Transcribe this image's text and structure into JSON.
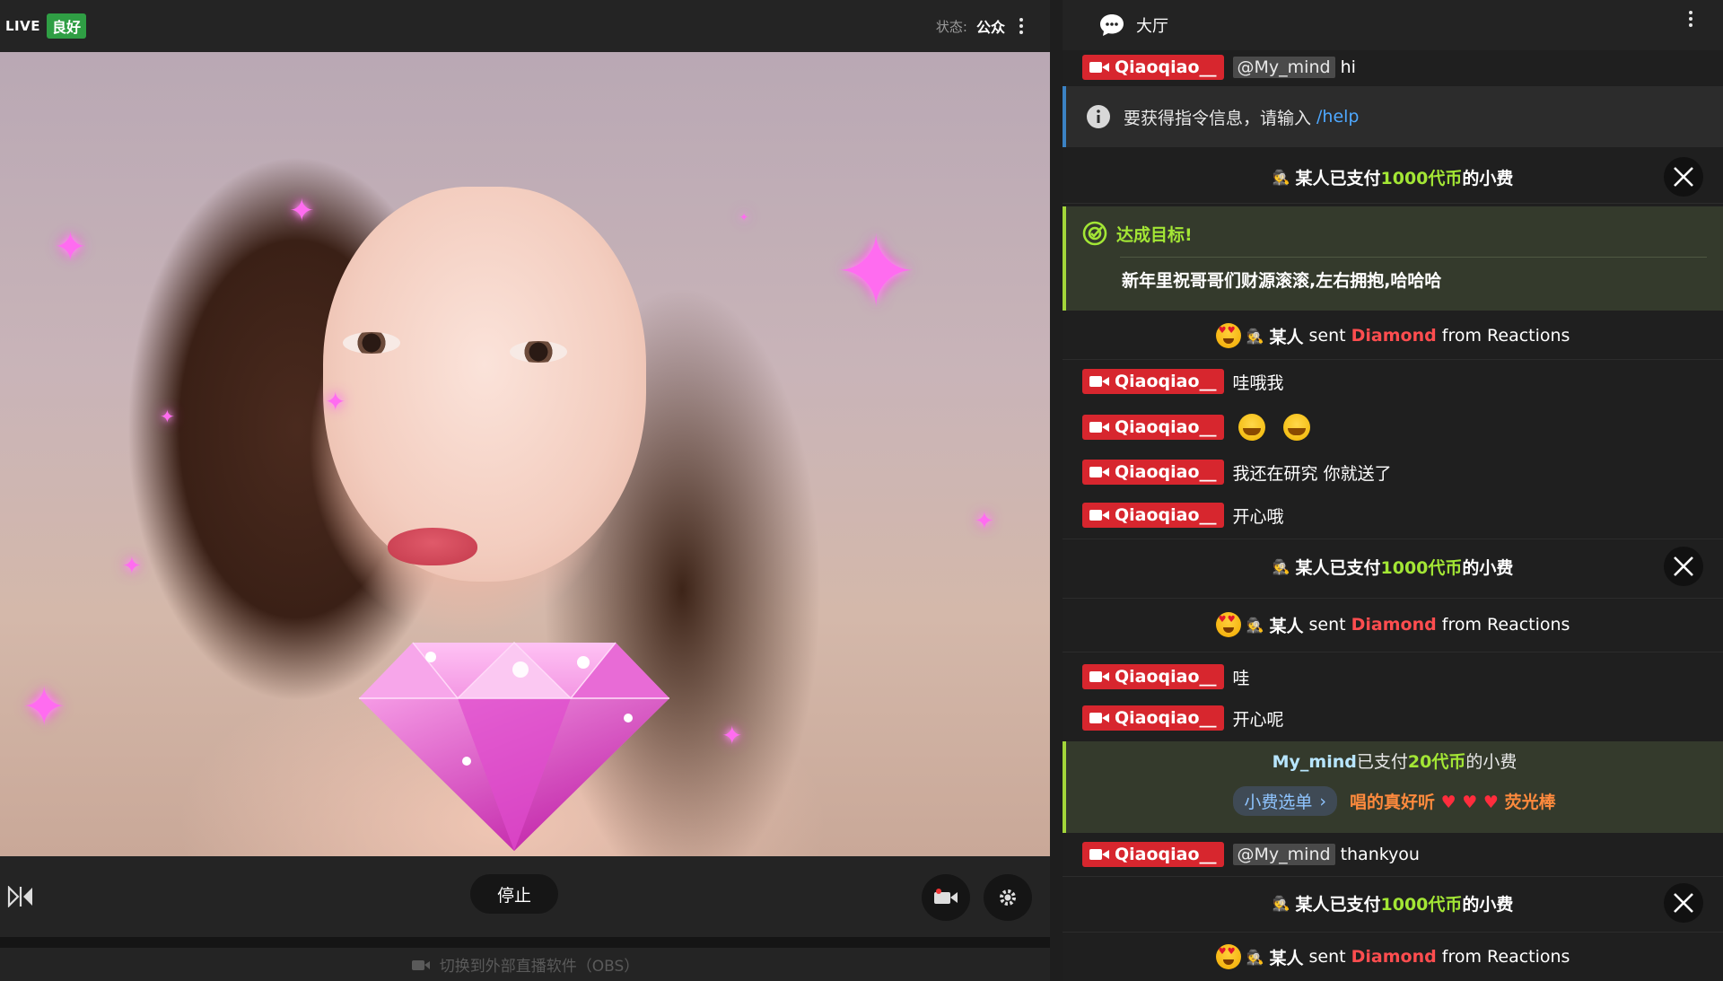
{
  "stream": {
    "live_label": "LIVE",
    "quality_badge": "良好",
    "status_label": "状态:",
    "status_value": "公众",
    "stop_label": "停止",
    "obs_label": "切换到外部直播软件（OBS）"
  },
  "chat": {
    "title": "大厅",
    "messages": [
      {
        "user": "Qiaoqiao__",
        "mention": "@My_mind",
        "text": "hi"
      },
      {
        "info_text": "要获得指令信息，请输入",
        "info_link": "/help"
      },
      {
        "tip_prefix": "某人已支付",
        "tip_amount": "1000代币",
        "tip_suffix": "的小费"
      },
      {
        "goal_title": "达成目标!",
        "goal_text": "新年里祝哥哥们财源滚滚,左右拥抱,哈哈哈"
      },
      {
        "reaction_actor": "某人",
        "reaction_verb": "sent",
        "reaction_item": "Diamond",
        "reaction_source": "from Reactions"
      },
      {
        "user": "Qiaoqiao__",
        "text": "哇哦我"
      },
      {
        "user": "Qiaoqiao__",
        "text": ""
      },
      {
        "user": "Qiaoqiao__",
        "text": "我还在研究 你就送了"
      },
      {
        "user": "Qiaoqiao__",
        "text": "开心哦"
      },
      {
        "tip_prefix": "某人已支付",
        "tip_amount": "1000代币",
        "tip_suffix": "的小费"
      },
      {
        "reaction_actor": "某人",
        "reaction_verb": "sent",
        "reaction_item": "Diamond",
        "reaction_source": "from Reactions"
      },
      {
        "user": "Qiaoqiao__",
        "text": "哇"
      },
      {
        "user": "Qiaoqiao__",
        "text": "开心呢"
      },
      {
        "menu_user": "My_mind",
        "menu_mid": "已支付",
        "menu_amount": "20代币",
        "menu_suffix": "的小费",
        "menu_button": "小费选单",
        "menu_item_pre": "唱的真好听",
        "menu_item_post": "荧光棒"
      },
      {
        "user": "Qiaoqiao__",
        "mention": "@My_mind",
        "text": "thankyou"
      },
      {
        "tip_prefix": "某人已支付",
        "tip_amount": "1000代币",
        "tip_suffix": "的小费"
      },
      {
        "reaction_actor": "某人",
        "reaction_verb": "sent",
        "reaction_item": "Diamond",
        "reaction_source": "from Reactions"
      }
    ]
  },
  "colors": {
    "user_tag": "#d7262e",
    "tip_amount": "#a3e635",
    "diamond": "#ff4d4f",
    "info_link": "#4ea8ff",
    "goal_bg": "#343a2c"
  },
  "icons": {
    "chat_header": "chat-bubble-icon",
    "user_tag": "video-camera-icon",
    "tip": "incognito-hat-icon",
    "tip_action": "x-logo-icon",
    "goal": "target-icon",
    "info": "info-icon",
    "reaction": "heart-eyes-emoji-icon"
  }
}
